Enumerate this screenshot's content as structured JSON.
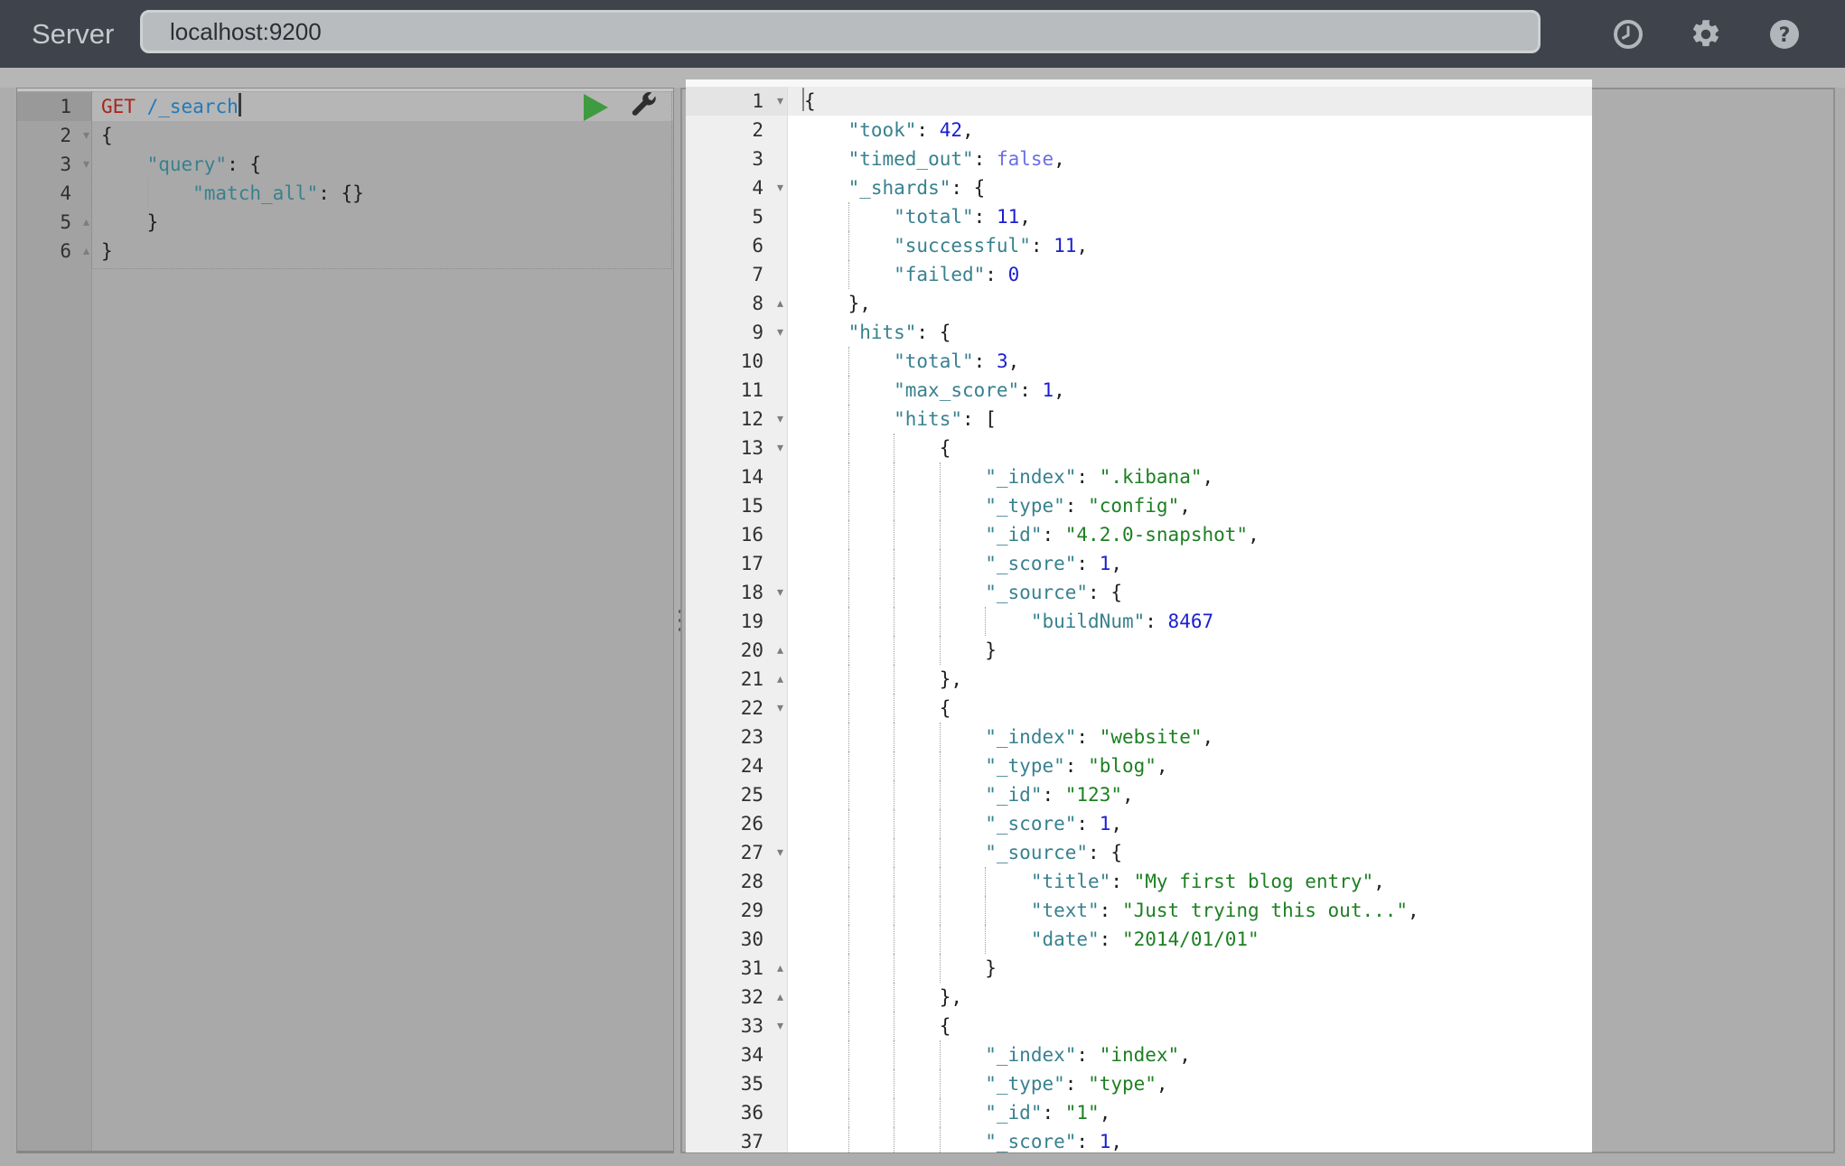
{
  "topbar": {
    "server_label": "Server",
    "server_value": "localhost:9200",
    "icons": [
      "history-icon",
      "settings-icon",
      "help-icon"
    ]
  },
  "colors": {
    "topbar_bg": "#3e434c",
    "page_bg": "#adadad",
    "request_editor_bg": "#a9a9a9",
    "response_editor_bg": "#ffffff",
    "method_red": "#a8251c",
    "url_blue": "#2279b8",
    "key_teal": "#38818f",
    "string_green": "#1d7f22",
    "number_blue": "#1a1fd0",
    "boolean_purple": "#6b6ee4",
    "play_green": "#3f9b3f"
  },
  "request_editor": {
    "lines": [
      {
        "n": 1,
        "i": 0,
        "f": "",
        "a": 1,
        "cur": "end",
        "t": [
          [
            "m",
            "GET"
          ],
          [
            "p",
            " "
          ],
          [
            "u",
            "/_search"
          ]
        ]
      },
      {
        "n": 2,
        "i": 0,
        "f": "o",
        "t": [
          [
            "p",
            "{"
          ]
        ]
      },
      {
        "n": 3,
        "i": 4,
        "f": "o",
        "t": [
          [
            "k",
            "\"query\""
          ],
          [
            "p",
            ": {"
          ]
        ]
      },
      {
        "n": 4,
        "i": 8,
        "f": "",
        "t": [
          [
            "k",
            "\"match_all\""
          ],
          [
            "p",
            ": {}"
          ]
        ]
      },
      {
        "n": 5,
        "i": 4,
        "f": "e",
        "t": [
          [
            "p",
            "}"
          ]
        ]
      },
      {
        "n": 6,
        "i": 0,
        "f": "e",
        "t": [
          [
            "p",
            "}"
          ]
        ]
      }
    ]
  },
  "response_editor": {
    "lines": [
      {
        "n": 1,
        "i": 0,
        "f": "o",
        "a": 1,
        "cur": "start",
        "t": [
          [
            "p",
            "{"
          ]
        ]
      },
      {
        "n": 2,
        "i": 4,
        "f": "",
        "t": [
          [
            "k",
            "\"took\""
          ],
          [
            "p",
            ": "
          ],
          [
            "n",
            "42"
          ],
          [
            "p",
            ","
          ]
        ]
      },
      {
        "n": 3,
        "i": 4,
        "f": "",
        "t": [
          [
            "k",
            "\"timed_out\""
          ],
          [
            "p",
            ": "
          ],
          [
            "b",
            "false"
          ],
          [
            "p",
            ","
          ]
        ]
      },
      {
        "n": 4,
        "i": 4,
        "f": "o",
        "t": [
          [
            "k",
            "\"_shards\""
          ],
          [
            "p",
            ": {"
          ]
        ]
      },
      {
        "n": 5,
        "i": 8,
        "f": "",
        "t": [
          [
            "k",
            "\"total\""
          ],
          [
            "p",
            ": "
          ],
          [
            "n",
            "11"
          ],
          [
            "p",
            ","
          ]
        ]
      },
      {
        "n": 6,
        "i": 8,
        "f": "",
        "t": [
          [
            "k",
            "\"successful\""
          ],
          [
            "p",
            ": "
          ],
          [
            "n",
            "11"
          ],
          [
            "p",
            ","
          ]
        ]
      },
      {
        "n": 7,
        "i": 8,
        "f": "",
        "t": [
          [
            "k",
            "\"failed\""
          ],
          [
            "p",
            ": "
          ],
          [
            "n",
            "0"
          ]
        ]
      },
      {
        "n": 8,
        "i": 4,
        "f": "e",
        "t": [
          [
            "p",
            "},"
          ]
        ]
      },
      {
        "n": 9,
        "i": 4,
        "f": "o",
        "t": [
          [
            "k",
            "\"hits\""
          ],
          [
            "p",
            ": {"
          ]
        ]
      },
      {
        "n": 10,
        "i": 8,
        "f": "",
        "t": [
          [
            "k",
            "\"total\""
          ],
          [
            "p",
            ": "
          ],
          [
            "n",
            "3"
          ],
          [
            "p",
            ","
          ]
        ]
      },
      {
        "n": 11,
        "i": 8,
        "f": "",
        "t": [
          [
            "k",
            "\"max_score\""
          ],
          [
            "p",
            ": "
          ],
          [
            "n",
            "1"
          ],
          [
            "p",
            ","
          ]
        ]
      },
      {
        "n": 12,
        "i": 8,
        "f": "o",
        "t": [
          [
            "k",
            "\"hits\""
          ],
          [
            "p",
            ": ["
          ]
        ]
      },
      {
        "n": 13,
        "i": 12,
        "f": "o",
        "t": [
          [
            "p",
            "{"
          ]
        ]
      },
      {
        "n": 14,
        "i": 16,
        "f": "",
        "t": [
          [
            "k",
            "\"_index\""
          ],
          [
            "p",
            ": "
          ],
          [
            "s",
            "\".kibana\""
          ],
          [
            "p",
            ","
          ]
        ]
      },
      {
        "n": 15,
        "i": 16,
        "f": "",
        "t": [
          [
            "k",
            "\"_type\""
          ],
          [
            "p",
            ": "
          ],
          [
            "s",
            "\"config\""
          ],
          [
            "p",
            ","
          ]
        ]
      },
      {
        "n": 16,
        "i": 16,
        "f": "",
        "t": [
          [
            "k",
            "\"_id\""
          ],
          [
            "p",
            ": "
          ],
          [
            "s",
            "\"4.2.0-snapshot\""
          ],
          [
            "p",
            ","
          ]
        ]
      },
      {
        "n": 17,
        "i": 16,
        "f": "",
        "t": [
          [
            "k",
            "\"_score\""
          ],
          [
            "p",
            ": "
          ],
          [
            "n",
            "1"
          ],
          [
            "p",
            ","
          ]
        ]
      },
      {
        "n": 18,
        "i": 16,
        "f": "o",
        "t": [
          [
            "k",
            "\"_source\""
          ],
          [
            "p",
            ": {"
          ]
        ]
      },
      {
        "n": 19,
        "i": 20,
        "f": "",
        "t": [
          [
            "k",
            "\"buildNum\""
          ],
          [
            "p",
            ": "
          ],
          [
            "n",
            "8467"
          ]
        ]
      },
      {
        "n": 20,
        "i": 16,
        "f": "e",
        "t": [
          [
            "p",
            "}"
          ]
        ]
      },
      {
        "n": 21,
        "i": 12,
        "f": "e",
        "t": [
          [
            "p",
            "},"
          ]
        ]
      },
      {
        "n": 22,
        "i": 12,
        "f": "o",
        "t": [
          [
            "p",
            "{"
          ]
        ]
      },
      {
        "n": 23,
        "i": 16,
        "f": "",
        "t": [
          [
            "k",
            "\"_index\""
          ],
          [
            "p",
            ": "
          ],
          [
            "s",
            "\"website\""
          ],
          [
            "p",
            ","
          ]
        ]
      },
      {
        "n": 24,
        "i": 16,
        "f": "",
        "t": [
          [
            "k",
            "\"_type\""
          ],
          [
            "p",
            ": "
          ],
          [
            "s",
            "\"blog\""
          ],
          [
            "p",
            ","
          ]
        ]
      },
      {
        "n": 25,
        "i": 16,
        "f": "",
        "t": [
          [
            "k",
            "\"_id\""
          ],
          [
            "p",
            ": "
          ],
          [
            "s",
            "\"123\""
          ],
          [
            "p",
            ","
          ]
        ]
      },
      {
        "n": 26,
        "i": 16,
        "f": "",
        "t": [
          [
            "k",
            "\"_score\""
          ],
          [
            "p",
            ": "
          ],
          [
            "n",
            "1"
          ],
          [
            "p",
            ","
          ]
        ]
      },
      {
        "n": 27,
        "i": 16,
        "f": "o",
        "t": [
          [
            "k",
            "\"_source\""
          ],
          [
            "p",
            ": {"
          ]
        ]
      },
      {
        "n": 28,
        "i": 20,
        "f": "",
        "t": [
          [
            "k",
            "\"title\""
          ],
          [
            "p",
            ": "
          ],
          [
            "s",
            "\"My first blog entry\""
          ],
          [
            "p",
            ","
          ]
        ]
      },
      {
        "n": 29,
        "i": 20,
        "f": "",
        "t": [
          [
            "k",
            "\"text\""
          ],
          [
            "p",
            ": "
          ],
          [
            "s",
            "\"Just trying this out...\""
          ],
          [
            "p",
            ","
          ]
        ]
      },
      {
        "n": 30,
        "i": 20,
        "f": "",
        "t": [
          [
            "k",
            "\"date\""
          ],
          [
            "p",
            ": "
          ],
          [
            "s",
            "\"2014/01/01\""
          ]
        ]
      },
      {
        "n": 31,
        "i": 16,
        "f": "e",
        "t": [
          [
            "p",
            "}"
          ]
        ]
      },
      {
        "n": 32,
        "i": 12,
        "f": "e",
        "t": [
          [
            "p",
            "},"
          ]
        ]
      },
      {
        "n": 33,
        "i": 12,
        "f": "o",
        "t": [
          [
            "p",
            "{"
          ]
        ]
      },
      {
        "n": 34,
        "i": 16,
        "f": "",
        "t": [
          [
            "k",
            "\"_index\""
          ],
          [
            "p",
            ": "
          ],
          [
            "s",
            "\"index\""
          ],
          [
            "p",
            ","
          ]
        ]
      },
      {
        "n": 35,
        "i": 16,
        "f": "",
        "t": [
          [
            "k",
            "\"_type\""
          ],
          [
            "p",
            ": "
          ],
          [
            "s",
            "\"type\""
          ],
          [
            "p",
            ","
          ]
        ]
      },
      {
        "n": 36,
        "i": 16,
        "f": "",
        "t": [
          [
            "k",
            "\"_id\""
          ],
          [
            "p",
            ": "
          ],
          [
            "s",
            "\"1\""
          ],
          [
            "p",
            ","
          ]
        ]
      },
      {
        "n": 37,
        "i": 16,
        "f": "",
        "t": [
          [
            "k",
            "\"_score\""
          ],
          [
            "p",
            ": "
          ],
          [
            "n",
            "1"
          ],
          [
            "p",
            ","
          ]
        ]
      }
    ]
  }
}
